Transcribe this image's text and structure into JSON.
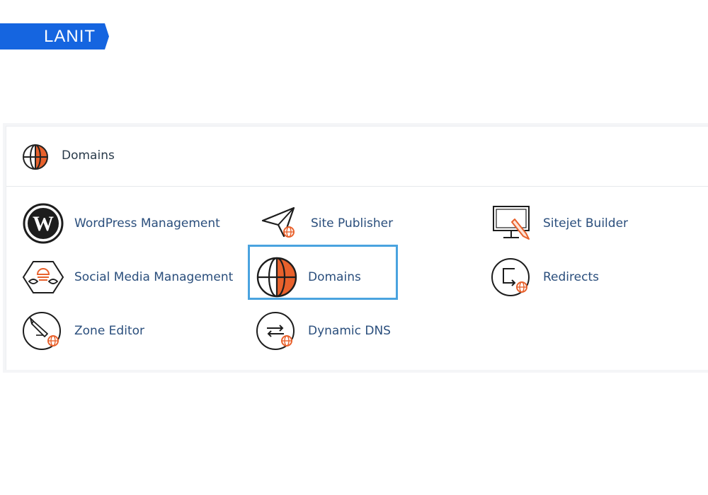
{
  "brand": {
    "name": "LANIT",
    "color": "#1565e0"
  },
  "panel": {
    "title": "Domains",
    "icon": "globe-icon"
  },
  "items": [
    {
      "label": "WordPress Management",
      "icon": "wordpress-icon"
    },
    {
      "label": "Site Publisher",
      "icon": "paper-plane-icon"
    },
    {
      "label": "Sitejet Builder",
      "icon": "monitor-pencil-icon"
    },
    {
      "label": "Social Media Management",
      "icon": "social-media-icon"
    },
    {
      "label": "Domains",
      "icon": "globe-icon",
      "highlighted": true
    },
    {
      "label": "Redirects",
      "icon": "redirect-icon"
    },
    {
      "label": "Zone Editor",
      "icon": "zone-editor-icon"
    },
    {
      "label": "Dynamic DNS",
      "icon": "dynamic-dns-icon"
    }
  ],
  "colors": {
    "accent": "#e8612c",
    "highlight": "#4aa3df",
    "link": "#2a4e7c"
  }
}
